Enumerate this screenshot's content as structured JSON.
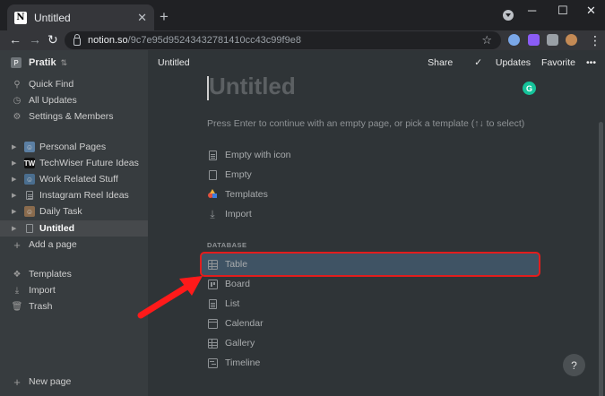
{
  "browser": {
    "tab_title": "Untitled",
    "new_tab": "+",
    "url_host": "notion.so",
    "url_path": "/9c7e95d95243432781410cc43c99f9e8",
    "minimize": "─",
    "maximize": "☐",
    "close": "✕"
  },
  "sidebar": {
    "workspace": "Pratik",
    "top_items": [
      {
        "label": "Quick Find",
        "icon": "search-icon"
      },
      {
        "label": "All Updates",
        "icon": "clock-icon"
      },
      {
        "label": "Settings & Members",
        "icon": "gear-icon"
      }
    ],
    "pages": [
      {
        "label": "Personal Pages",
        "emoji": "🧔"
      },
      {
        "label": "TechWiser Future Ideas",
        "badge": "TW"
      },
      {
        "label": "Work Related Stuff",
        "emoji": "🧑‍💻"
      },
      {
        "label": "Instagram Reel Ideas",
        "icon": "doc"
      },
      {
        "label": "Daily Task",
        "emoji": "🐱"
      },
      {
        "label": "Untitled",
        "icon": "doc",
        "active": true
      }
    ],
    "add_page": "Add a page",
    "bottom_items": [
      {
        "label": "Templates",
        "icon": "templates-icon"
      },
      {
        "label": "Import",
        "icon": "import-icon"
      },
      {
        "label": "Trash",
        "icon": "trash-icon"
      }
    ],
    "new_page": "New page"
  },
  "main": {
    "breadcrumb_title": "Untitled",
    "share": "Share",
    "updates": "Updates",
    "favorite": "Favorite",
    "more": "•••",
    "page_title_placeholder": "Untitled",
    "hint": "Press Enter to continue with an empty page, or pick a template (↑↓ to select)",
    "options": [
      {
        "label": "Empty with icon"
      },
      {
        "label": "Empty"
      },
      {
        "label": "Templates"
      },
      {
        "label": "Import"
      }
    ],
    "database_label": "DATABASE",
    "database_options": [
      {
        "label": "Table"
      },
      {
        "label": "Board"
      },
      {
        "label": "List"
      },
      {
        "label": "Calendar"
      },
      {
        "label": "Gallery"
      },
      {
        "label": "Timeline"
      }
    ],
    "help": "?"
  },
  "colors": {
    "highlight_border": "#e21d1d",
    "arrow": "#ff1a1a",
    "grammarly": "#15c39a"
  }
}
